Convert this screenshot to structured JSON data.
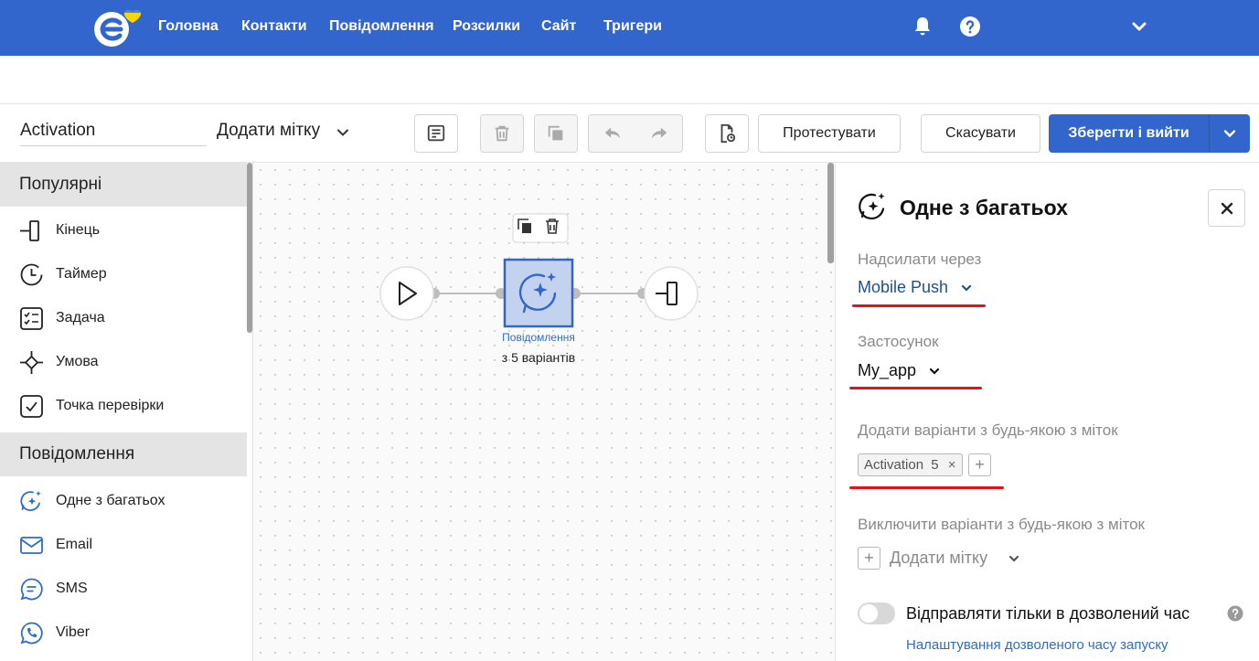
{
  "nav": {
    "items": [
      "Головна",
      "Контакти",
      "Повідомлення",
      "Розсилки",
      "Сайт",
      "Тригери"
    ],
    "icons": [
      "bell-icon",
      "help-icon",
      "chevron-down-icon"
    ],
    "brand_color": "#3366cc"
  },
  "toolbar": {
    "flow_name": "Activation",
    "add_tag_label": "Додати мітку",
    "test_label": "Протестувати",
    "cancel_label": "Скасувати",
    "save_label": "Зберегти і вийти"
  },
  "sidebar": {
    "sections": [
      {
        "title": "Популярні",
        "items": [
          {
            "label": "Кінець",
            "icon": "end-icon"
          },
          {
            "label": "Таймер",
            "icon": "timer-icon"
          },
          {
            "label": "Задача",
            "icon": "task-icon"
          },
          {
            "label": "Умова",
            "icon": "condition-icon"
          },
          {
            "label": "Точка перевірки",
            "icon": "checkpoint-icon"
          }
        ]
      },
      {
        "title": "Повідомлення",
        "items": [
          {
            "label": "Одне з багатьох",
            "icon": "sparkle-chat-icon"
          },
          {
            "label": "Email",
            "icon": "envelope-icon"
          },
          {
            "label": "SMS",
            "icon": "sms-icon"
          },
          {
            "label": "Viber",
            "icon": "viber-icon"
          }
        ]
      }
    ]
  },
  "canvas": {
    "node_type_label": "Повідомлення",
    "node_subtitle": "з 5 варіантів"
  },
  "panel": {
    "title": "Одне з багатьох",
    "send_via_label": "Надсилати через",
    "send_via_value": "Mobile Push",
    "app_label": "Застосунок",
    "app_value": "My_app",
    "include_label": "Додати варіанти з будь-якою з міток",
    "include_chip": {
      "name": "Activation",
      "count": "5"
    },
    "exclude_label": "Виключити варіанти з будь-якою з міток",
    "exclude_add_label": "Додати мітку",
    "toggle_label": "Відправляти тільки в дозволений час",
    "toggle_on": false,
    "settings_link": "Налаштування дозволеного часу запуску",
    "highlight_color": "#e0141b"
  }
}
